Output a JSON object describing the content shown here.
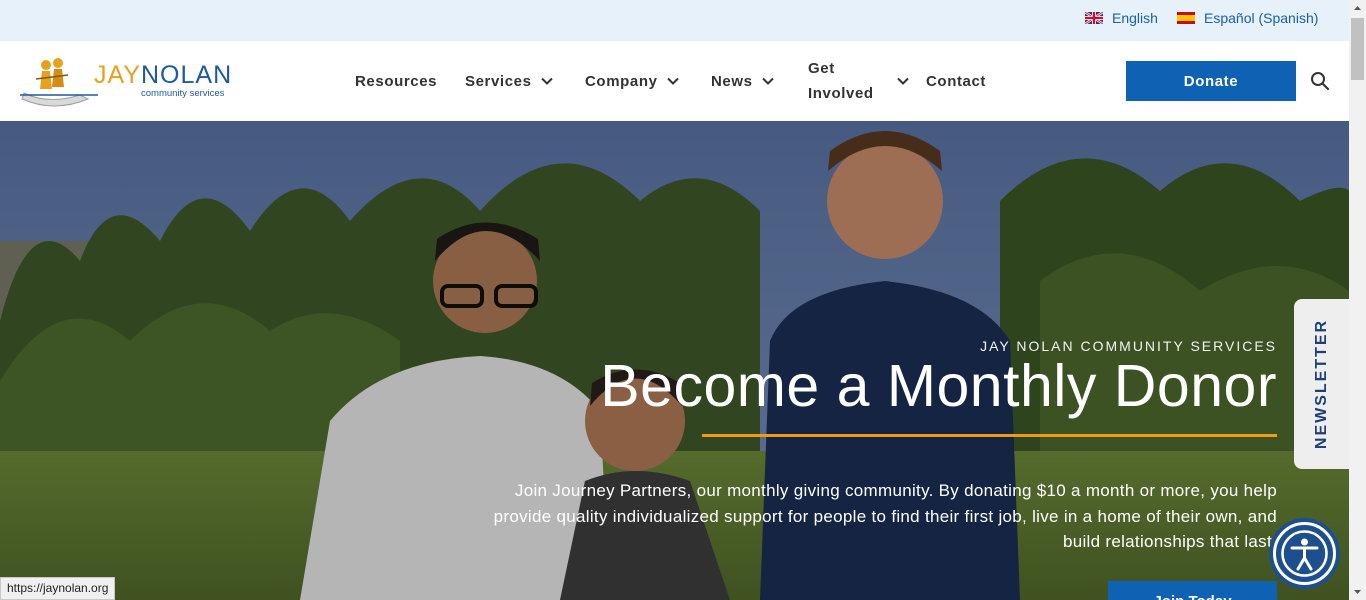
{
  "language_bar": {
    "english": "English",
    "spanish": "Español (Spanish)"
  },
  "logo": {
    "name_part1": "JAY",
    "name_part2": "NOLAN",
    "subtitle": "community services"
  },
  "nav": {
    "resources": "Resources",
    "services": "Services",
    "company": "Company",
    "news": "News",
    "get_involved_line1": "Get",
    "get_involved_line2": "Involved",
    "contact": "Contact"
  },
  "header": {
    "donate_label": "Donate"
  },
  "hero": {
    "eyebrow": "JAY NOLAN COMMUNITY SERVICES",
    "headline": "Become a Monthly Donor",
    "body": "Join Journey Partners, our monthly giving community. By donating $10 a month or more, you help provide quality individualized support for people to find their first job, live in a home of their own, and build relationships that last.",
    "cta_label": "Join Today"
  },
  "newsletter_tab": "NEWSLETTER",
  "status_bar_url": "https://jaynolan.org",
  "colors": {
    "brand_blue": "#0f62b3",
    "accent_orange": "#ef9b17",
    "lang_bar_bg": "#e6f1fa"
  },
  "icons": {
    "uk_flag": "uk-flag-icon",
    "spain_flag": "spain-flag-icon",
    "search": "search-icon",
    "chevron": "chevron-down-icon",
    "accessibility": "accessibility-icon"
  }
}
